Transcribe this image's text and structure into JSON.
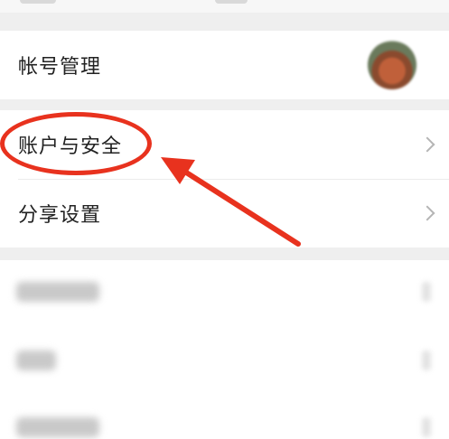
{
  "account_section": {
    "account_management_label": "帐号管理"
  },
  "settings_section": {
    "items": [
      {
        "label": "账户与安全"
      },
      {
        "label": "分享设置"
      }
    ]
  },
  "annotation": {
    "color": "#e8321e"
  },
  "icons": {
    "chevron": "chevron-right-icon",
    "avatar": "avatar"
  }
}
